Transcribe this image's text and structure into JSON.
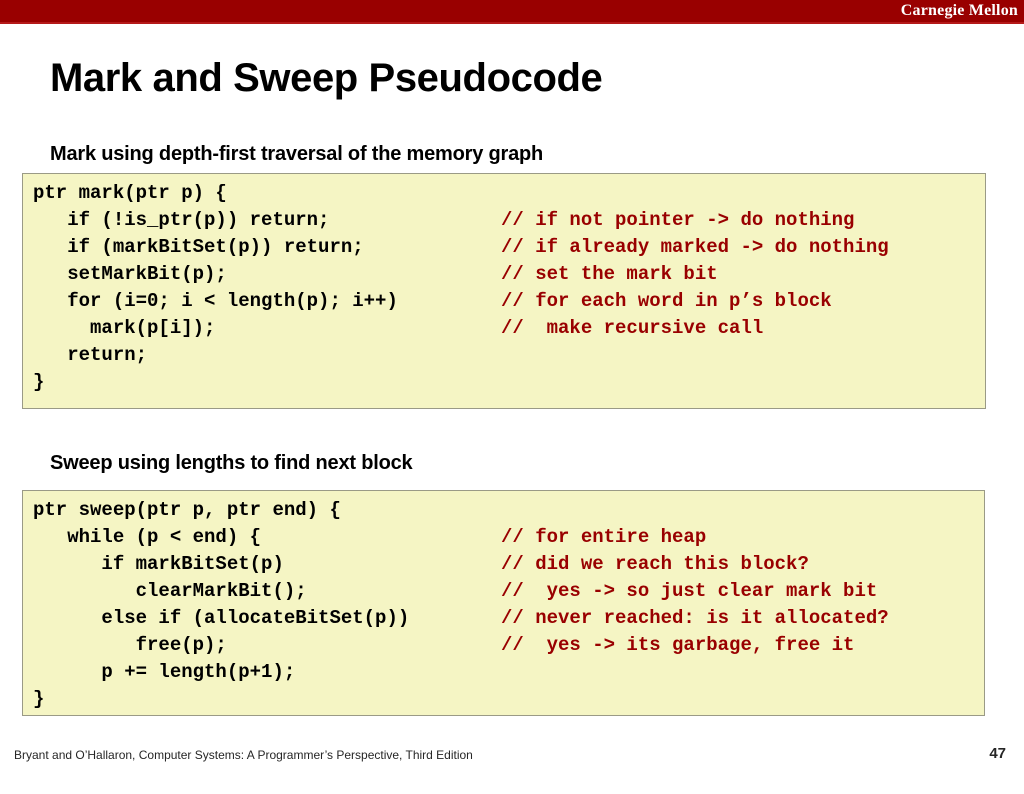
{
  "banner": {
    "brand": "Carnegie Mellon",
    "color": "#990000"
  },
  "slide": {
    "title": "Mark and Sweep Pseudocode",
    "page_number": "47",
    "footer": "Bryant and O’Hallaron, Computer Systems: A Programmer’s Perspective, Third Edition"
  },
  "sections": [
    {
      "heading": "Mark using depth-first traversal of the memory graph",
      "code_lines": [
        {
          "code": "ptr mark(ptr p) {",
          "comment": ""
        },
        {
          "code": "   if (!is_ptr(p)) return;",
          "comment": "// if not pointer -> do nothing"
        },
        {
          "code": "   if (markBitSet(p)) return;",
          "comment": "// if already marked -> do nothing"
        },
        {
          "code": "   setMarkBit(p);",
          "comment": "// set the mark bit"
        },
        {
          "code": "   for (i=0; i < length(p); i++)",
          "comment": "// for each word in p’s block"
        },
        {
          "code": "     mark(p[i]);",
          "comment": "//  make recursive call"
        },
        {
          "code": "   return;",
          "comment": ""
        },
        {
          "code": "}",
          "comment": ""
        }
      ]
    },
    {
      "heading": "Sweep using lengths to find next block",
      "code_lines": [
        {
          "code": "ptr sweep(ptr p, ptr end) {",
          "comment": ""
        },
        {
          "code": "   while (p < end) {",
          "comment": "// for entire heap"
        },
        {
          "code": "      if markBitSet(p)",
          "comment": "// did we reach this block?"
        },
        {
          "code": "         clearMarkBit();",
          "comment": "//  yes -> so just clear mark bit"
        },
        {
          "code": "      else if (allocateBitSet(p))",
          "comment": "// never reached: is it allocated?"
        },
        {
          "code": "         free(p);",
          "comment": "//  yes -> its garbage, free it"
        },
        {
          "code": "      p += length(p+1);",
          "comment": ""
        },
        {
          "code": "}",
          "comment": ""
        }
      ]
    }
  ],
  "colors": {
    "banner_red": "#990000",
    "code_background": "#f5f5c4",
    "code_border": "#9a9a86",
    "comment_red": "#990000",
    "code_foreground": "#000000"
  }
}
